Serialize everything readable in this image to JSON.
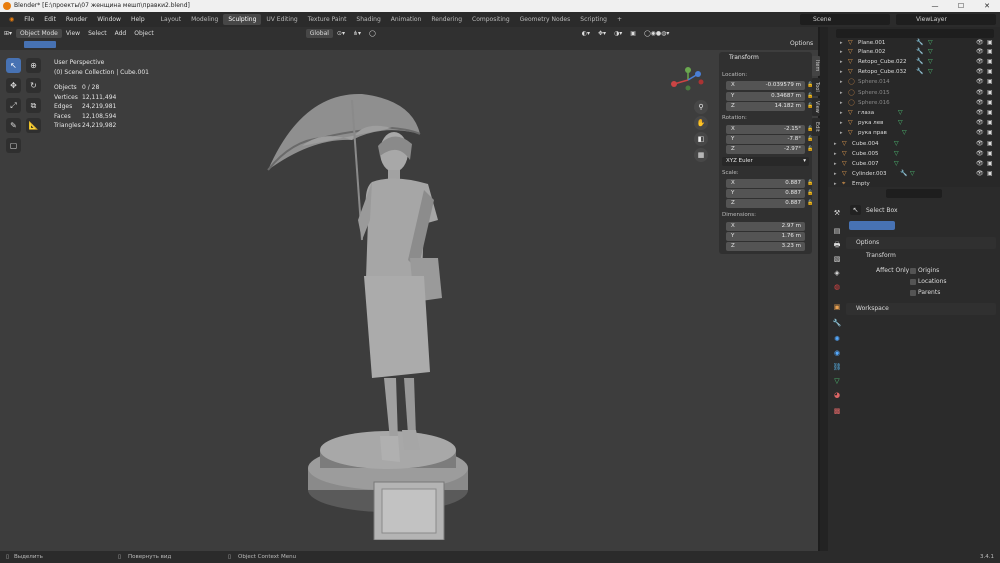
{
  "titlebar": {
    "title": "Blender* [E:\\проекты\\07 женщина мешп\\правки2.blend]"
  },
  "menu": [
    "File",
    "Edit",
    "Render",
    "Window",
    "Help"
  ],
  "workspaces": [
    "Layout",
    "Modeling",
    "Sculpting",
    "UV Editing",
    "Texture Paint",
    "Shading",
    "Animation",
    "Rendering",
    "Compositing",
    "Geometry Nodes",
    "Scripting"
  ],
  "active_workspace": "Sculpting",
  "scene": "Scene",
  "view_layer": "ViewLayer",
  "viewport_header": {
    "mode": "Object Mode",
    "view": "View",
    "select": "Select",
    "add": "Add",
    "object": "Object",
    "orientation": "Global",
    "options": "Options"
  },
  "overlay": {
    "perspective": "User Perspective",
    "collection": "(0) Scene Collection | Cube.001",
    "stats": [
      {
        "k": "Objects",
        "v": "0 / 28"
      },
      {
        "k": "Vertices",
        "v": "12,111,494"
      },
      {
        "k": "Edges",
        "v": "24,219,981"
      },
      {
        "k": "Faces",
        "v": "12,108,594"
      },
      {
        "k": "Triangles",
        "v": "24,219,982"
      }
    ]
  },
  "npanel": {
    "title": "Transform",
    "location_label": "Location:",
    "location": [
      {
        "ax": "X",
        "v": "-0.039579 m"
      },
      {
        "ax": "Y",
        "v": "0.34687 m"
      },
      {
        "ax": "Z",
        "v": "14.182 m"
      }
    ],
    "rotation_label": "Rotation:",
    "rotation": [
      {
        "ax": "X",
        "v": "-2.15°"
      },
      {
        "ax": "Y",
        "v": "-7.8°"
      },
      {
        "ax": "Z",
        "v": "-2.97°"
      }
    ],
    "rotation_mode": "XYZ Euler",
    "scale_label": "Scale:",
    "scale": [
      {
        "ax": "X",
        "v": "0.887"
      },
      {
        "ax": "Y",
        "v": "0.887"
      },
      {
        "ax": "Z",
        "v": "0.887"
      }
    ],
    "dimensions_label": "Dimensions:",
    "dimensions": [
      {
        "ax": "X",
        "v": "2.97 m"
      },
      {
        "ax": "Y",
        "v": "1.76 m"
      },
      {
        "ax": "Z",
        "v": "3.23 m"
      }
    ],
    "tabs": [
      "Item",
      "Tool",
      "View",
      "Edit"
    ]
  },
  "outliner": {
    "rows": [
      {
        "name": "Plane.001",
        "dim": false
      },
      {
        "name": "Plane.002",
        "dim": false
      },
      {
        "name": "Retopo_Cube.022",
        "dim": false
      },
      {
        "name": "Retopo_Cube.032",
        "dim": false
      },
      {
        "name": "Sphere.014",
        "dim": true
      },
      {
        "name": "Sphere.015",
        "dim": true
      },
      {
        "name": "Sphere.016",
        "dim": true
      },
      {
        "name": "глаза",
        "dim": false
      },
      {
        "name": "рука лев",
        "dim": false
      },
      {
        "name": "рука прав",
        "dim": false
      },
      {
        "name": "Cube.004",
        "dim": false
      },
      {
        "name": "Cube.005",
        "dim": false
      },
      {
        "name": "Cube.007",
        "dim": false
      },
      {
        "name": "Cylinder.003",
        "dim": false
      },
      {
        "name": "Empty",
        "dim": false
      }
    ]
  },
  "properties": {
    "tool_name": "Select Box",
    "options": "Options",
    "transform": "Transform",
    "affect_only": "Affect Only",
    "origins": "Origins",
    "locations": "Locations",
    "parents": "Parents",
    "workspace": "Workspace"
  },
  "statusbar": {
    "left": "Выделить",
    "mid": "Повернуть вид",
    "right": "Object Context Menu",
    "version": "3.4.1"
  }
}
